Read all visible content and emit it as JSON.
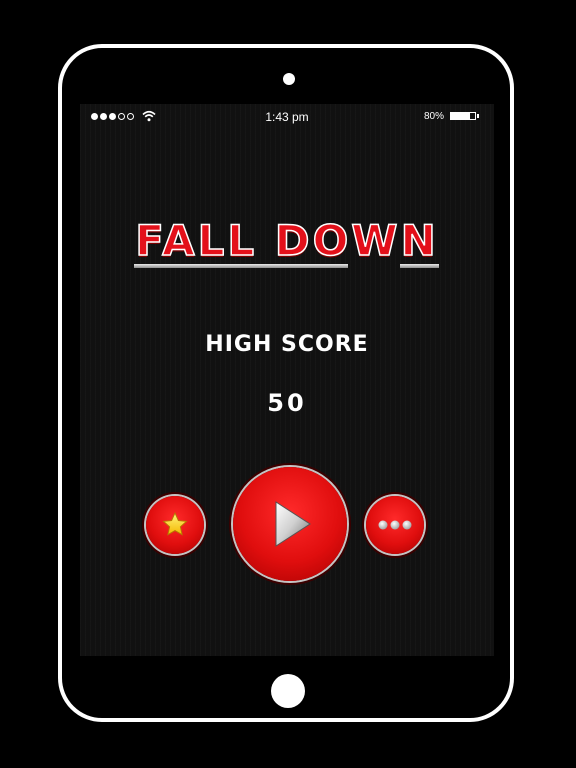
{
  "status_bar": {
    "time": "1:43 pm",
    "battery_percent": "80%",
    "battery_level": 0.8,
    "signal_bars": [
      true,
      true,
      true,
      false,
      false
    ]
  },
  "game": {
    "title": "FALL DOWN",
    "high_score_label": "HIGH SCORE",
    "high_score_value": "50"
  },
  "buttons": {
    "rate": {
      "icon": "star-icon"
    },
    "play": {
      "icon": "play-icon"
    },
    "more": {
      "icon": "more-icon"
    }
  },
  "colors": {
    "accent_red": "#e3101a",
    "star_yellow": "#ffd21a",
    "frame": "#ffffff",
    "background": "#000000"
  }
}
